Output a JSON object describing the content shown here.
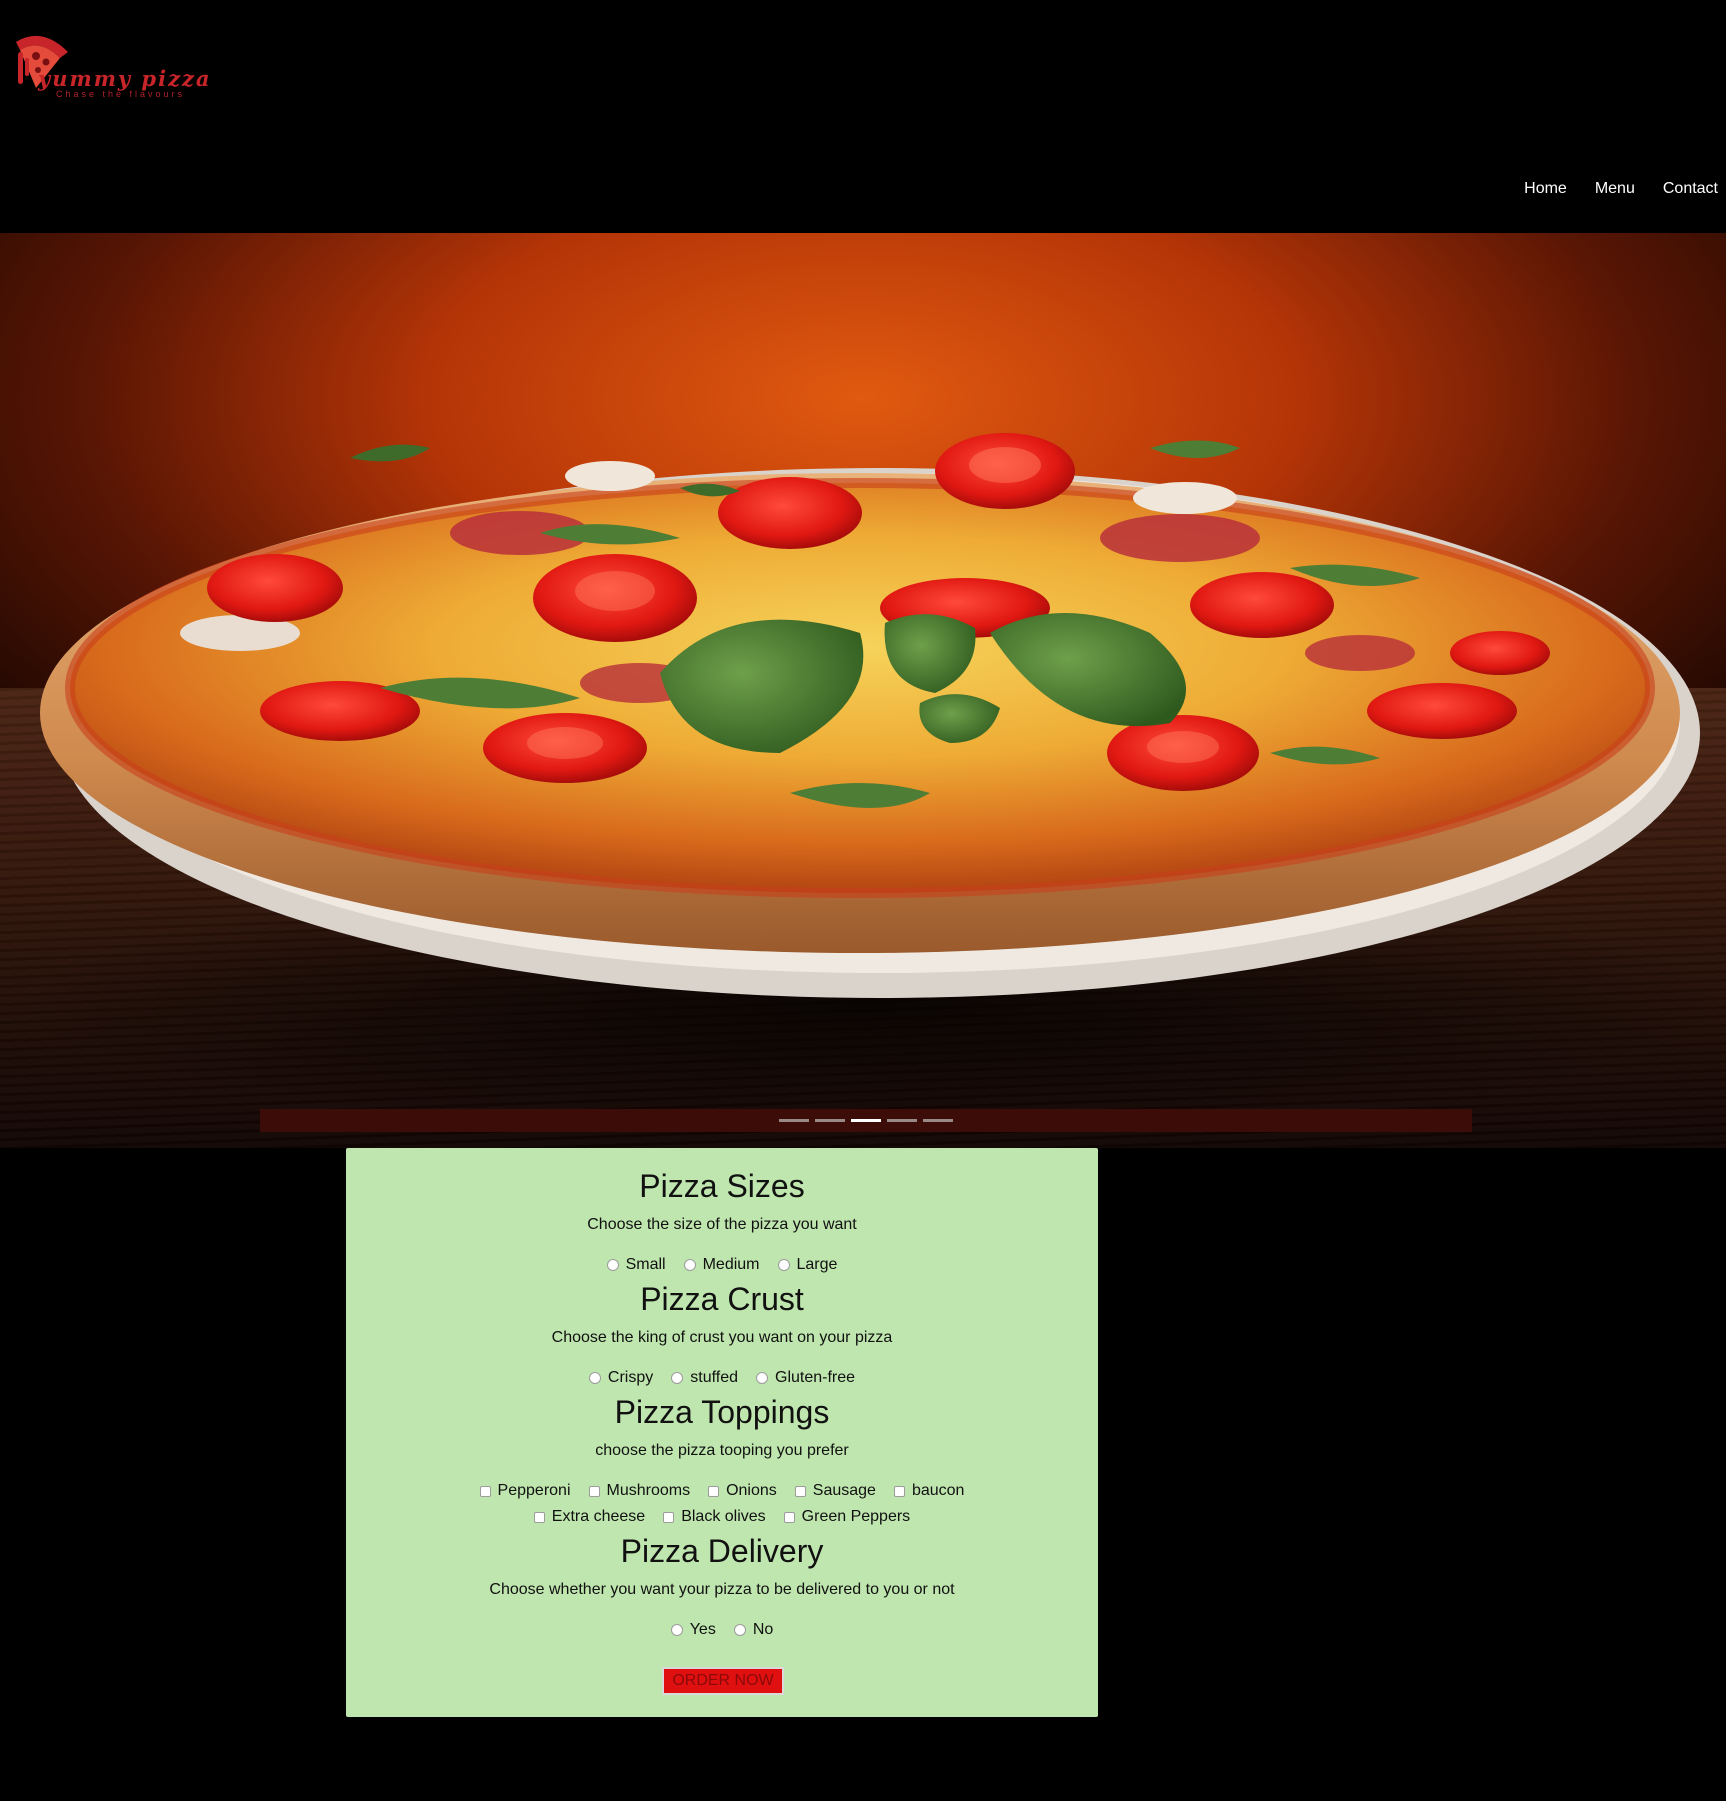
{
  "brand": {
    "name": "yummy pizza",
    "tagline": "Chase the flavours",
    "accent_color": "#c8252a",
    "logo_icon": "pizza-slice-icon"
  },
  "nav": {
    "items": [
      {
        "label": "Home"
      },
      {
        "label": "Menu"
      },
      {
        "label": "Contact"
      }
    ]
  },
  "hero": {
    "image": "pizza-photo",
    "slider": {
      "slide_count": 5,
      "active_index": 2
    }
  },
  "order_form": {
    "background_color": "#bfe6ae",
    "sizes": {
      "title": "Pizza Sizes",
      "description": "Choose the size of the pizza you want",
      "options": [
        "Small",
        "Medium",
        "Large"
      ]
    },
    "crust": {
      "title": "Pizza Crust",
      "description": "Choose the king of crust you want on your pizza",
      "options": [
        "Crispy",
        "stuffed",
        "Gluten-free"
      ]
    },
    "toppings": {
      "title": "Pizza Toppings",
      "description": "choose the pizza tooping you prefer",
      "options": [
        "Pepperoni",
        "Mushrooms",
        "Onions",
        "Sausage",
        "baucon",
        "Extra cheese",
        "Black olives",
        "Green Peppers"
      ]
    },
    "delivery": {
      "title": "Pizza Delivery",
      "description": "Choose whether you want your pizza to be delivered to you or not",
      "options": [
        "Yes",
        "No"
      ]
    },
    "submit_label": "ORDER NOW",
    "submit_color": "#e01010"
  }
}
